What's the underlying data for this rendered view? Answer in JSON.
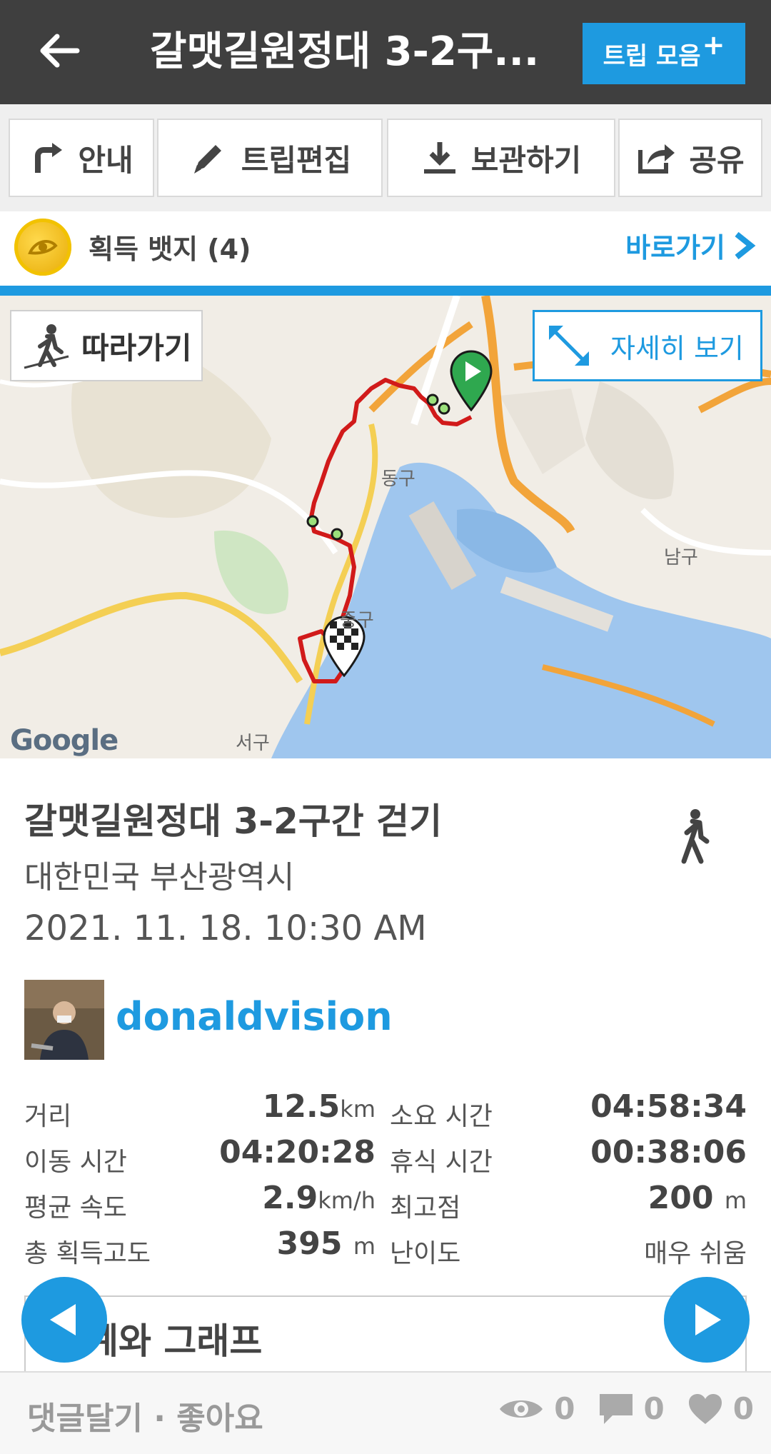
{
  "header": {
    "title": "갈맷길원정대 3-2구...",
    "trip_button": "트립 모음",
    "trip_button_plus": "+"
  },
  "toolbar": {
    "guide": "안내",
    "edit": "트립편집",
    "save": "보관하기",
    "share": "공유"
  },
  "badges": {
    "label": "획득 뱃지 (4)",
    "link": "바로가기"
  },
  "map": {
    "follow": "따라가기",
    "detail": "자세히 보기",
    "labels": {
      "dong_gu": "동구",
      "nam_gu": "남구",
      "seo_gu": "서구",
      "jung_gu": "중구"
    },
    "attribution": "Google"
  },
  "trip": {
    "name": "갈맷길원정대 3-2구간 걷기",
    "location": "대한민국 부산광역시",
    "date": "2021. 11. 18. 10:30 AM",
    "user": "donaldvision"
  },
  "stats": {
    "distance_label": "거리",
    "distance_value": "12.5",
    "distance_unit": "km",
    "duration_label": "소요 시간",
    "duration_value": "04:58:34",
    "moving_label": "이동 시간",
    "moving_value": "04:20:28",
    "rest_label": "휴식 시간",
    "rest_value": "00:38:06",
    "avgspeed_label": "평균 속도",
    "avgspeed_value": "2.9",
    "avgspeed_unit": "km/h",
    "maxalt_label": "최고점",
    "maxalt_value": "200",
    "maxalt_unit": "m",
    "gain_label": "총 획득고도",
    "gain_value": "395",
    "gain_unit": "m",
    "difficulty_label": "난이도",
    "difficulty_value": "매우 쉬움"
  },
  "graph": {
    "title": "계와 그래프"
  },
  "bottom": {
    "comment_like": "댓글달기 · 좋아요",
    "views": "0",
    "comments": "0",
    "likes": "0"
  },
  "colors": {
    "accent": "#1e9ae0",
    "header": "#3f3f3f",
    "route": "#d11a1a"
  }
}
